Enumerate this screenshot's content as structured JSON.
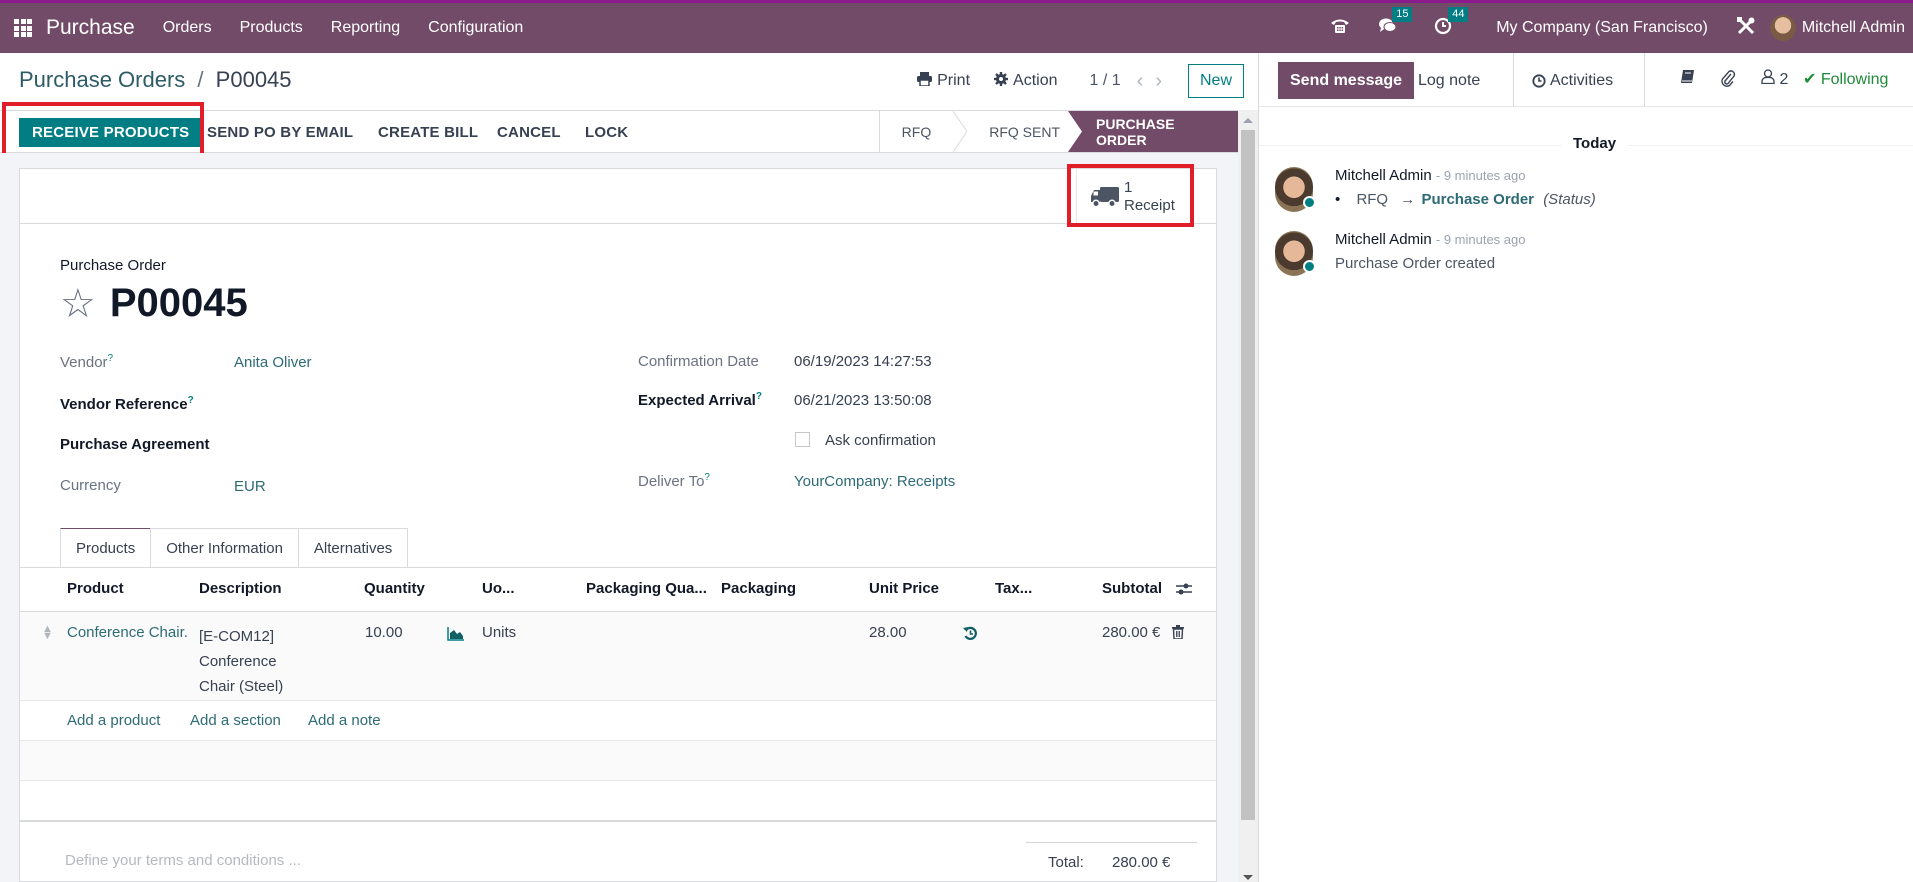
{
  "topbar": {
    "app_name": "Purchase",
    "menu": [
      "Orders",
      "Products",
      "Reporting",
      "Configuration"
    ],
    "icons": [
      "phone-icon",
      "chat-icon",
      "clock-icon",
      "tools-icon"
    ],
    "messages_count": "15",
    "activities_count": "44",
    "company": "My Company (San Francisco)",
    "user": "Mitchell Admin"
  },
  "control": {
    "breadcrumb_parent": "Purchase Orders",
    "breadcrumb_separator": "/",
    "breadcrumb_current": "P00045",
    "print_label": "Print",
    "action_label": "Action",
    "pager": "1 / 1",
    "new_label": "New"
  },
  "statusbar": {
    "buttons": [
      "RECEIVE PRODUCTS",
      "SEND PO BY EMAIL",
      "CREATE BILL",
      "CANCEL",
      "LOCK"
    ],
    "stages": [
      "RFQ",
      "RFQ SENT",
      "PURCHASE ORDER"
    ],
    "active_stage": "PURCHASE ORDER"
  },
  "smart_button": {
    "count": "1",
    "label": "Receipt"
  },
  "form": {
    "type_label": "Purchase Order",
    "number": "P00045",
    "left_fields": [
      {
        "label": "Vendor",
        "value": "Anita Oliver",
        "help": "?"
      },
      {
        "label": "Vendor Reference",
        "value": "",
        "help": "?"
      },
      {
        "label": "Purchase Agreement",
        "value": ""
      },
      {
        "label": "Currency",
        "value": "EUR"
      }
    ],
    "right_fields": [
      {
        "label": "Confirmation Date",
        "value": "06/19/2023 14:27:53"
      },
      {
        "label": "Expected Arrival",
        "value": "06/21/2023 13:50:08",
        "help": "?"
      },
      {
        "label": "",
        "value": "Ask confirmation",
        "checked": false
      },
      {
        "label": "Deliver To",
        "value": "YourCompany: Receipts",
        "help": "?"
      }
    ]
  },
  "tabs": [
    "Products",
    "Other Information",
    "Alternatives"
  ],
  "active_tab": "Products",
  "table": {
    "columns": [
      "Product",
      "Description",
      "Quantity",
      "Uo...",
      "Packaging Qua...",
      "Packaging",
      "Unit Price",
      "Tax...",
      "Subtotal"
    ],
    "rows": [
      {
        "product": "Conference Chair.",
        "description_lines": [
          "[E-COM12]",
          "Conference",
          "Chair (Steel)"
        ],
        "quantity": "10.00",
        "uom": "Units",
        "packaging_qty": "",
        "packaging": "",
        "unit_price": "28.00",
        "taxes": "",
        "subtotal": "280.00 €"
      }
    ],
    "add_links": [
      "Add a product",
      "Add a section",
      "Add a note"
    ]
  },
  "footer": {
    "terms_placeholder": "Define your terms and conditions ...",
    "total_label": "Total:",
    "total_value": "280.00 €"
  },
  "chatter": {
    "send_message": "Send message",
    "log_note": "Log note",
    "activities": "Activities",
    "followers_count": "2",
    "following": "Following",
    "date_separator": "Today",
    "messages": [
      {
        "author": "Mitchell Admin",
        "time": "- 9 minutes ago",
        "old_value": "RFQ",
        "arrow": "→",
        "new_value": "Purchase Order",
        "field": "(Status)"
      },
      {
        "author": "Mitchell Admin",
        "time": "- 9 minutes ago",
        "body": "Purchase Order created"
      }
    ]
  },
  "colors": {
    "brand": "#714b67",
    "accent": "#017e84",
    "highlight": "#e11d2a",
    "following": "#1f8b3a"
  }
}
